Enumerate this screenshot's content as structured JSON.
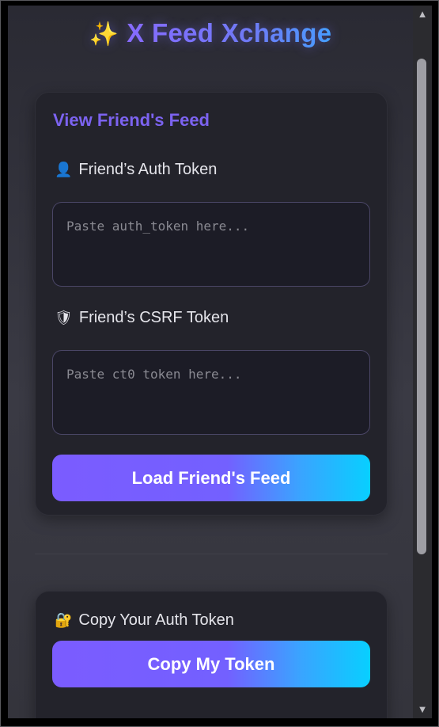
{
  "app": {
    "sparkle_icon": "✨",
    "title": "X Feed Xchange"
  },
  "feed_card": {
    "heading": "View Friend's Feed",
    "auth_label": "Friend’s Auth Token",
    "auth_icon": "👤",
    "auth_placeholder": "Paste auth_token here...",
    "auth_value": "",
    "csrf_label": "Friend’s CSRF Token",
    "csrf_icon": "🛡",
    "csrf_placeholder": "Paste ct0 token here...",
    "csrf_value": "",
    "load_button": "Load Friend's Feed"
  },
  "copy_card": {
    "label": "Copy Your Auth Token",
    "label_icon": "🔐",
    "copy_button": "Copy My Token"
  },
  "colors": {
    "accent_purple": "#7c63f0",
    "gradient_start": "#7b5cff",
    "gradient_end": "#08cfff",
    "card_bg": "#23232b",
    "input_bg": "#1c1c26"
  },
  "scrollbar": {
    "up_icon": "▲",
    "down_icon": "▼"
  }
}
